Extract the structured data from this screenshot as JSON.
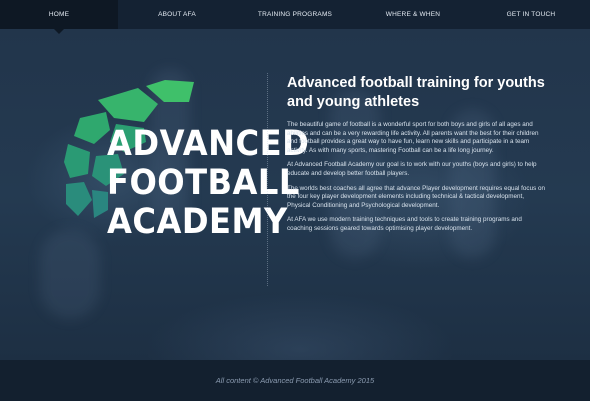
{
  "nav": {
    "items": [
      {
        "label": "HOME",
        "active": true
      },
      {
        "label": "ABOUT AFA",
        "active": false
      },
      {
        "label": "TRAINING PROGRAMS",
        "active": false
      },
      {
        "label": "WHERE & WHEN",
        "active": false
      },
      {
        "label": "GET IN TOUCH",
        "active": false
      }
    ]
  },
  "logo": {
    "lines": [
      "ADVANCED",
      "FOOTBALL",
      "ACADEMY"
    ],
    "colors": {
      "green_light": "#3fc06a",
      "green_dark": "#1f9a6f",
      "teal": "#2a8a86"
    }
  },
  "content": {
    "heading": "Advanced football training for youths and young athletes",
    "paragraphs": [
      "The beautiful game of football is a wonderful sport for both boys and girls of all ages and abilities and can be a very rewarding life activity. All parents want the best for their children and football provides a great way to have fun, learn new skills and participate in a team activity. As with many sports, mastering Football can be a life long journey.",
      "At Advanced Football Academy our goal is to work with our youths (boys and girls) to help educate and develop better football players.",
      "The worlds best coaches all agree that advance Player development requires equal focus on the four key player development elements including technical & tactical development, Physical Conditioning and Psychological development.",
      "At AFA we use modern training techniques and tools to create training programs and coaching sessions geared towards optimising player development."
    ]
  },
  "footer": {
    "text": "All content © Advanced Football Academy 2015"
  },
  "colors": {
    "background": "#1f3145",
    "nav_bg": "#142233",
    "footer_bg": "#13202f"
  }
}
